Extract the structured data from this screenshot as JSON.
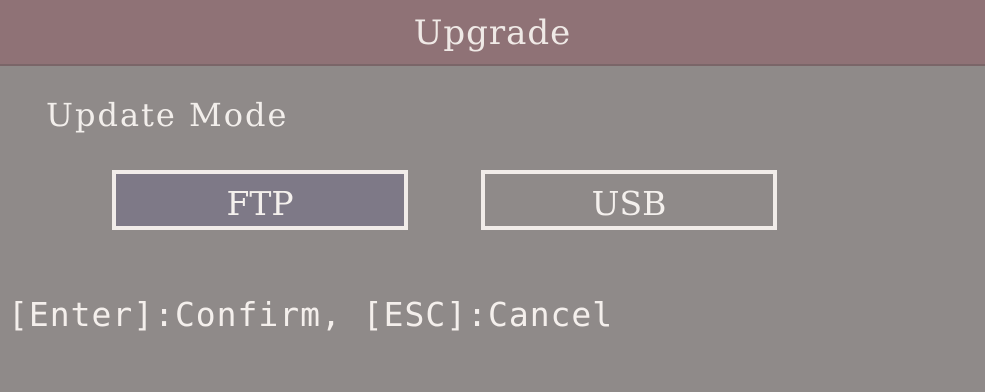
{
  "dialog": {
    "title": "Upgrade",
    "section_label": "Update Mode",
    "options": [
      {
        "label": "FTP",
        "selected": true
      },
      {
        "label": "USB",
        "selected": false
      }
    ],
    "hint": "[Enter]:Confirm, [ESC]:Cancel"
  },
  "colors": {
    "title_bar": "#8f7276",
    "background": "#8f8a89",
    "selected_button": "#7e7987",
    "button_border": "#f1ece9",
    "text": "#f4f0ed"
  }
}
